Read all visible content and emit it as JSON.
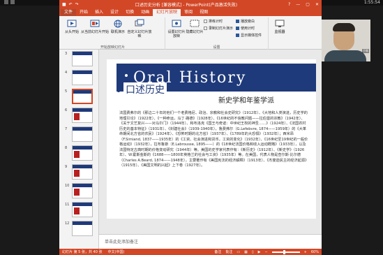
{
  "system": {
    "clock": "1:55:54"
  },
  "window": {
    "title": "口述历史分析 [兼容模式] - PowerPoint(产品激活失败)",
    "qat": [
      "save-icon",
      "undo-icon",
      "redo-icon"
    ],
    "controls": [
      "?",
      "—",
      "▢",
      "✕"
    ]
  },
  "tabs": [
    "文件",
    "开始",
    "插入",
    "设计",
    "切换",
    "动画",
    "幻灯片放映",
    "审阅",
    "视图"
  ],
  "ribbon": {
    "start_group": {
      "label": "开始放映幻灯片",
      "buttons": [
        "从头开始",
        "从当前幻灯片开始",
        "联机演示",
        "自定义幻灯片放映"
      ]
    },
    "setup_group": {
      "label": "设置",
      "big": [
        "设置幻灯片放映",
        "隐藏幻灯片"
      ],
      "checks": [
        {
          "label": "排练计时",
          "checked": false
        },
        {
          "label": "录制幻灯片演示",
          "checked": false
        },
        {
          "label": "播放旁白",
          "checked": true
        },
        {
          "label": "使用计时",
          "checked": true
        },
        {
          "label": "显示媒体控件",
          "checked": true
        }
      ]
    },
    "monitor_group": {
      "label": "监视器",
      "buttons": [
        "监视器"
      ]
    }
  },
  "thumbnails": [
    {
      "num": "3"
    },
    {
      "num": "4"
    },
    {
      "num": "5",
      "selected": true
    },
    {
      "num": "6"
    },
    {
      "num": "7"
    },
    {
      "num": "8"
    },
    {
      "num": "9"
    },
    {
      "num": "10"
    },
    {
      "num": "11"
    },
    {
      "num": "12"
    }
  ],
  "slide": {
    "header_en": "Oral History",
    "title_cn": "口述历史",
    "subtitle": "新史学和年鉴学派",
    "paragraph": "法国费弗尔的《那边二十年的他们一个老费格尼、政治、宗教和社会史研究》（1912年）、《大地和人类演进，历史学的地理引论》（1922年）、《一种命运，马丁·路德》（1928年）、《16世纪的不信教问题——拉伯雷的宗教》（1942年）、《关于文艺复兴——对马尔门》（1944年）、和布洛克《国王与奇迹：中世纪王权的神圣……》（1924年）、《法国农村历史的基本特征》（1931年）、《封建社会》（1939-1940年），鲁费弗尔（G.Lefebvre, 1874——1959年）的《大革命期间北方省的农民》（1924年）、《恐怖时期的北方省》（1937年）、《1789年的大恐惧》（1932年）；西米昂（F.Simiand, 1837——1935年）的《工资、社会演进和货币，工资的变化》（1932年）、《16世纪至19世纪的一般价格运动》（1932年），拉布鲁斯（E.Labrousse, 1895——）的《18世纪法国价格和收入运动概略》（1933年），以及法国特定古典时期的价格变动研究（1944年）等。美国的史学家代表作有：《新历史》（1912年）、《新史学》（1926年）、W.霍斯金斯的《1688——1800年英格兰的社会与工资》（1935年）等。在美国，代表人物是查尔斯·比尔德（Charles A.Beard, 1874——1948年），主要著作有《美国宪法的经济解释》（1913年）、《杰斐逊民主的经济起源》（1915年）、《美国文明的兴起》上下卷（1927年）。"
  },
  "notes": {
    "placeholder": "单击此处添加备注"
  },
  "status": {
    "slide_info": "幻灯片 第 5 张，共 40 张",
    "language": "中文(中国)",
    "notes_label": "备注",
    "comments_label": "批注",
    "zoom": "60%"
  },
  "webcam": {
    "label": "于佩"
  }
}
